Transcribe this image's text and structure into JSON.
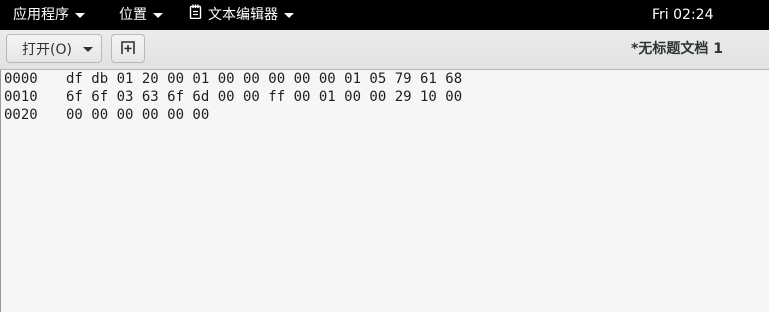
{
  "topbar": {
    "apps_menu": "应用程序",
    "places_menu": "位置",
    "app_menu": "文本编辑器",
    "clock": "Fri 02:24"
  },
  "toolbar": {
    "open_label": "打开(O)",
    "document_title": "*无标题文档 1"
  },
  "document": {
    "lines": [
      {
        "address": "0000",
        "bytes": "df db 01 20 00 01 00 00 00 00 00 01 05 79 61 68"
      },
      {
        "address": "0010",
        "bytes": "6f 6f 03 63 6f 6d 00 00 ff 00 01 00 00 29 10 00"
      },
      {
        "address": "0020",
        "bytes": "00 00 00 00 00 00"
      }
    ]
  },
  "icons": {
    "editor": "text-editor-icon",
    "new_tab": "new-tab-icon",
    "dropdown": "chevron-down-icon"
  },
  "colors": {
    "topbar_bg": "#000000",
    "headerbar_bg": "#e1e1e1",
    "editor_bg": "#f6f6f6",
    "text": "#1e1e1e"
  }
}
